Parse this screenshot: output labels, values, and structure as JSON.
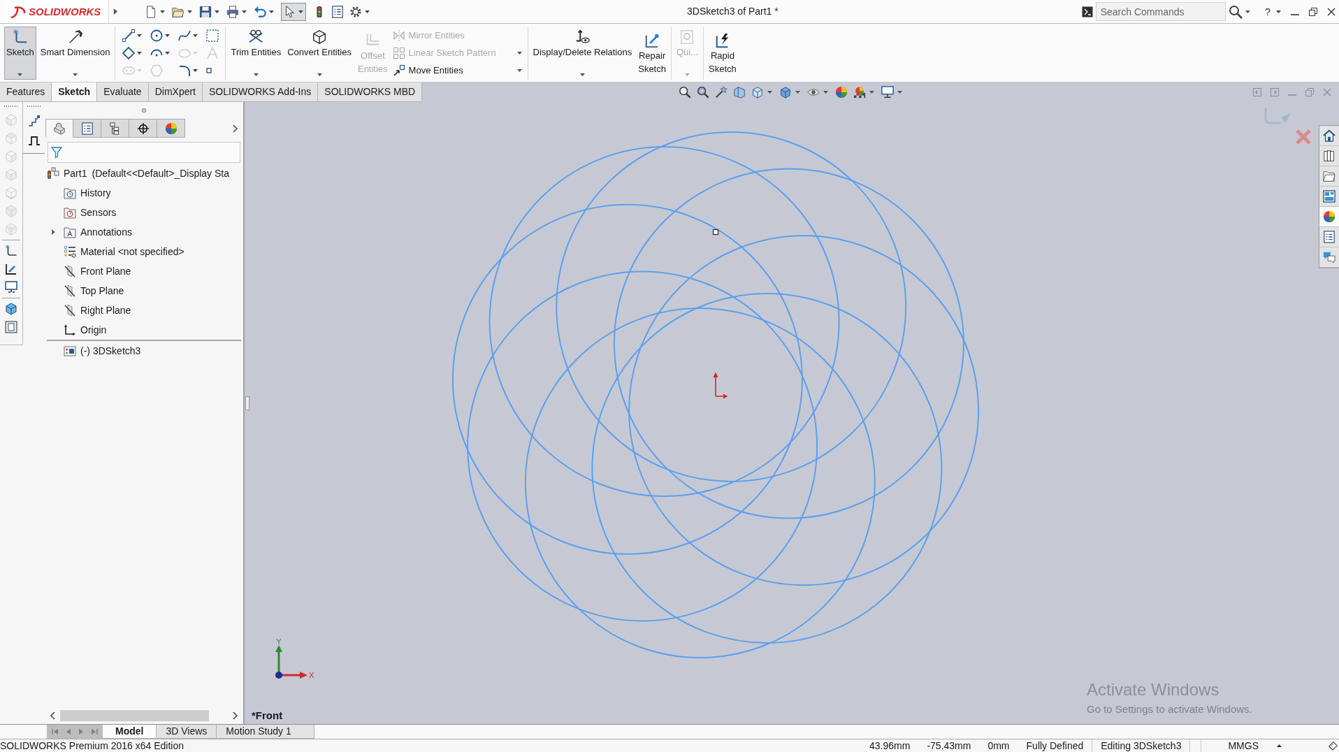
{
  "title_bar": {
    "logo": "SOLIDWORKS",
    "select_tool_pressed": true,
    "document_title": "3DSketch3 of Part1 *",
    "search": {
      "placeholder": "Search Commands"
    },
    "help": "?"
  },
  "ribbon": {
    "groups": [
      [
        {
          "kind": "large",
          "label": "Sketch",
          "selected": true,
          "disabled": false,
          "dropdown": true
        },
        {
          "kind": "large",
          "label": "Smart Dimension",
          "selected": false,
          "disabled": false,
          "dropdown": true
        }
      ],
      [
        {
          "kind": "grid",
          "tools": [
            {
              "disabled": false,
              "dropdown": true
            },
            {
              "disabled": false,
              "dropdown": true
            },
            {
              "disabled": false,
              "dropdown": true
            },
            {
              "disabled": false,
              "dropdown": false
            },
            {
              "disabled": false,
              "dropdown": true
            },
            {
              "disabled": false,
              "dropdown": true
            },
            {
              "disabled": true,
              "dropdown": true
            },
            {
              "disabled": true,
              "dropdown": false
            },
            {
              "disabled": true,
              "dropdown": true
            },
            {
              "disabled": true,
              "dropdown": false
            },
            {
              "disabled": false,
              "dropdown": true
            },
            {
              "disabled": false,
              "dropdown": false
            }
          ]
        }
      ],
      [
        {
          "kind": "large",
          "label": "Trim Entities",
          "selected": false,
          "disabled": false,
          "dropdown": true
        },
        {
          "kind": "large",
          "label": "Convert Entities",
          "selected": false,
          "disabled": false,
          "dropdown": true
        },
        {
          "kind": "large",
          "label": "Offset Entities",
          "selected": false,
          "disabled": true,
          "dropdown": false
        },
        {
          "kind": "stack",
          "entries": [
            {
              "label": "Mirror Entities",
              "disabled": true,
              "dropdown": false
            },
            {
              "label": "Linear Sketch Pattern",
              "disabled": true,
              "dropdown": true
            },
            {
              "label": "Move Entities",
              "disabled": false,
              "dropdown": true
            }
          ]
        }
      ],
      [
        {
          "kind": "large",
          "label": "Display/Delete Relations",
          "selected": false,
          "disabled": false,
          "dropdown": true
        },
        {
          "kind": "large",
          "label": "Repair Sketch",
          "selected": false,
          "disabled": false,
          "dropdown": false
        }
      ],
      [
        {
          "kind": "large",
          "label": "Qui...",
          "selected": false,
          "disabled": true,
          "dropdown": true
        }
      ],
      [
        {
          "kind": "large",
          "label": "Rapid Sketch",
          "selected": false,
          "disabled": false,
          "dropdown": false
        }
      ]
    ]
  },
  "command_tabs": [
    {
      "label": "Features",
      "selected": false
    },
    {
      "label": "Sketch",
      "selected": true
    },
    {
      "label": "Evaluate",
      "selected": false
    },
    {
      "label": "DimXpert",
      "selected": false
    },
    {
      "label": "SOLIDWORKS Add-Ins",
      "selected": false
    },
    {
      "label": "SOLIDWORKS MBD",
      "selected": false
    }
  ],
  "left_toolbar": [
    [
      {
        "disabled": true
      },
      {
        "disabled": true
      },
      {
        "disabled": true
      },
      {
        "disabled": true
      },
      {
        "disabled": true
      },
      {
        "disabled": true
      },
      {
        "disabled": true
      }
    ],
    [
      {
        "disabled": false
      },
      {
        "disabled": false
      },
      {
        "disabled": false
      }
    ],
    [
      {
        "disabled": false
      },
      {
        "disabled": false
      }
    ]
  ],
  "manager_tabs": [
    {
      "selected": true
    },
    {
      "selected": false
    },
    {
      "selected": false
    },
    {
      "selected": false
    },
    {
      "selected": false
    }
  ],
  "feature_tree": {
    "root": {
      "label": "Part1",
      "configuration": "(Default<<Default>_Display Sta",
      "children": [
        {
          "kind": "history",
          "label": "History",
          "expandable": false,
          "separator_above": false
        },
        {
          "kind": "sensors",
          "label": "Sensors",
          "expandable": false,
          "separator_above": false
        },
        {
          "kind": "annotations",
          "label": "Annotations",
          "expandable": true,
          "separator_above": false
        },
        {
          "kind": "material",
          "label": "Material <not specified>",
          "expandable": false,
          "separator_above": false
        },
        {
          "kind": "plane",
          "label": "Front Plane",
          "expandable": false,
          "separator_above": false
        },
        {
          "kind": "plane",
          "label": "Top Plane",
          "expandable": false,
          "separator_above": false
        },
        {
          "kind": "plane",
          "label": "Right Plane",
          "expandable": false,
          "separator_above": false
        },
        {
          "kind": "origin",
          "label": "Origin",
          "expandable": false,
          "separator_above": false
        },
        {
          "kind": "sketch",
          "label": "(-) 3DSketch3",
          "expandable": false,
          "separator_above": true
        }
      ]
    }
  },
  "viewport": {
    "view_name": "*Front",
    "triad": {
      "y_label": "Y",
      "x_label": "X"
    }
  },
  "task_pane": [
    {
      "selected": false
    },
    {
      "selected": false
    },
    {
      "selected": false
    },
    {
      "selected": false
    },
    {
      "selected": true
    },
    {
      "selected": false
    },
    {
      "selected": false
    }
  ],
  "bottom_tabs": [
    {
      "label": "Model",
      "selected": true
    },
    {
      "label": "3D Views",
      "selected": false
    },
    {
      "label": "Motion Study 1",
      "selected": false
    }
  ],
  "status_bar": {
    "edition": "SOLIDWORKS Premium 2016 x64 Edition",
    "readouts": [
      "43.96mm",
      "-75.43mm",
      "0mm"
    ],
    "sketch_status": "Fully Defined",
    "editing": "Editing 3DSketch3",
    "units": "MMGS"
  },
  "activation_notice": {
    "title": "Activate Windows",
    "message": "Go to Settings to activate Windows."
  }
}
